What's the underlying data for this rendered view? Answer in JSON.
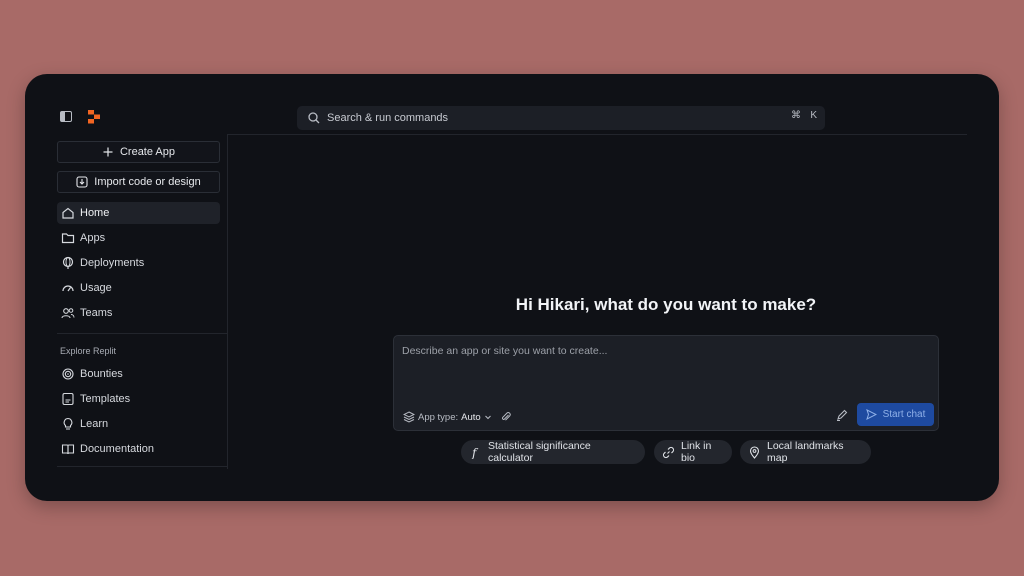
{
  "topbar": {
    "search_placeholder": "Search & run commands",
    "shortcut_key1": "⌘",
    "shortcut_key2": "K"
  },
  "sidebar": {
    "create_label": "Create App",
    "import_label": "Import code or design",
    "items": [
      {
        "label": "Home",
        "icon": "home-icon",
        "active": true
      },
      {
        "label": "Apps",
        "icon": "folder-icon"
      },
      {
        "label": "Deployments",
        "icon": "globe-icon"
      },
      {
        "label": "Usage",
        "icon": "gauge-icon"
      },
      {
        "label": "Teams",
        "icon": "users-icon"
      }
    ],
    "section_label": "Explore Replit",
    "explore_items": [
      {
        "label": "Bounties",
        "icon": "target-icon"
      },
      {
        "label": "Templates",
        "icon": "template-icon"
      },
      {
        "label": "Learn",
        "icon": "lightbulb-icon"
      },
      {
        "label": "Documentation",
        "icon": "book-icon"
      }
    ]
  },
  "main": {
    "greeting": "Hi Hikari, what do you want to make?",
    "prompt_placeholder": "Describe an app or site you want to create...",
    "app_type_label": "App type:",
    "app_type_value": "Auto",
    "start_label": "Start chat",
    "suggestions": [
      {
        "label": "Statistical significance calculator",
        "icon": "function-icon"
      },
      {
        "label": "Link in bio",
        "icon": "link-icon"
      },
      {
        "label": "Local landmarks map",
        "icon": "map-pin-icon"
      }
    ]
  },
  "colors": {
    "background": "#a86a67",
    "window": "#0f1116",
    "accent": "#1e4aa0",
    "logo": "#f26522"
  }
}
